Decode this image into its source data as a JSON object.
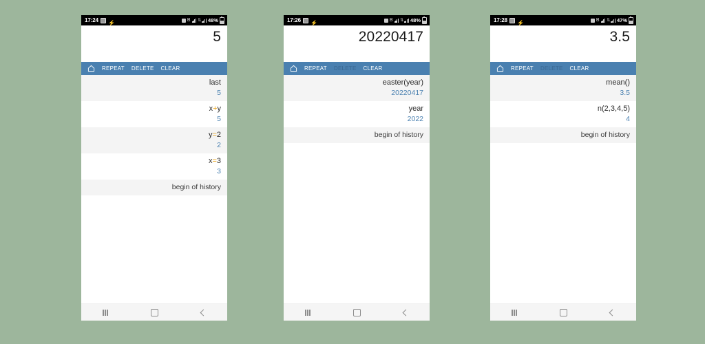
{
  "background_color": "#9db69c",
  "theme": {
    "toolbar_blue": "#4a80b0",
    "value_blue": "#4a80b0",
    "operator_orange": "#e8a317",
    "row_alt": "#f4f4f4",
    "row_base": "#ffffff",
    "statusbar_black": "#000000"
  },
  "toolbar": {
    "home_icon": "home-icon",
    "repeat_label": "REPEAT",
    "delete_label": "DELETE",
    "clear_label": "CLEAR"
  },
  "navbar": {
    "recents_icon": "recents-icon",
    "home_icon": "home-square-icon",
    "back_icon": "back-chevron-icon"
  },
  "phones": [
    {
      "id": "phone-1",
      "status": {
        "time": "17:24",
        "alarm_icon": "alarm-icon",
        "bolt_icon": "charging-bolt-icon",
        "vibrate_icon": "vibrate-icon",
        "bluetooth_icon": "bluetooth-icon",
        "signal_icon": "signal-bars-icon",
        "data_icon": "data-transfer-icon",
        "signal2_icon": "signal-bars-icon",
        "battery_text": "48%",
        "battery_icon": "battery-icon"
      },
      "display_value": "5",
      "delete_enabled": true,
      "history": [
        {
          "expr": "last",
          "value": "5"
        },
        {
          "expr": "x+y",
          "value": "5",
          "op": "+"
        },
        {
          "expr": "y=2",
          "value": "2",
          "op": "="
        },
        {
          "expr": "x=3",
          "value": "3",
          "op": "="
        }
      ],
      "history_end": "begin of history"
    },
    {
      "id": "phone-2",
      "status": {
        "time": "17:26",
        "alarm_icon": "alarm-icon",
        "bolt_icon": "charging-bolt-icon",
        "vibrate_icon": "vibrate-icon",
        "bluetooth_icon": "bluetooth-icon",
        "signal_icon": "signal-bars-icon",
        "data_icon": "data-transfer-icon",
        "signal2_icon": "signal-bars-icon",
        "battery_text": "48%",
        "battery_icon": "battery-icon"
      },
      "display_value": "20220417",
      "delete_enabled": false,
      "history": [
        {
          "expr": "easter(year)",
          "value": "20220417"
        },
        {
          "expr": "year",
          "value": "2022"
        }
      ],
      "history_end": "begin of history"
    },
    {
      "id": "phone-3",
      "status": {
        "time": "17:28",
        "alarm_icon": "alarm-icon",
        "bolt_icon": "charging-bolt-icon",
        "vibrate_icon": "vibrate-icon",
        "bluetooth_icon": "bluetooth-icon",
        "signal_icon": "signal-bars-icon",
        "data_icon": "data-transfer-icon",
        "signal2_icon": "signal-bars-icon",
        "battery_text": "47%",
        "battery_icon": "battery-icon"
      },
      "display_value": "3.5",
      "delete_enabled": false,
      "history": [
        {
          "expr": "mean()",
          "value": "3.5"
        },
        {
          "expr": "n(2,3,4,5)",
          "value": "4"
        }
      ],
      "history_end": "begin of history"
    }
  ]
}
